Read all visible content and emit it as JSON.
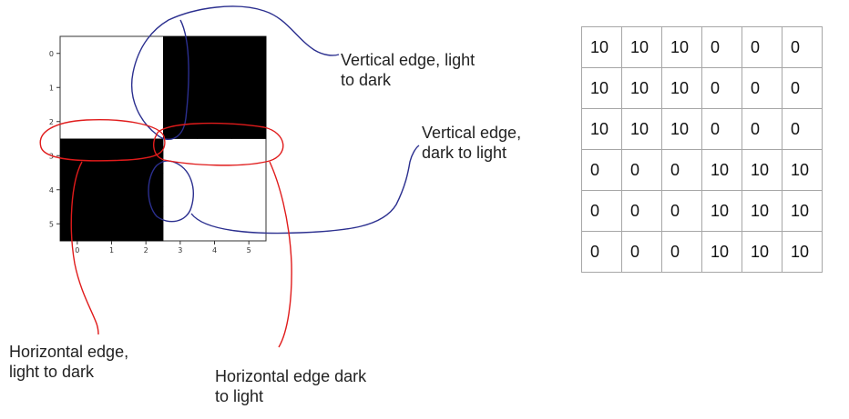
{
  "plot": {
    "image": [
      [
        0,
        0,
        0,
        1,
        1,
        1
      ],
      [
        0,
        0,
        0,
        1,
        1,
        1
      ],
      [
        0,
        0,
        0,
        1,
        1,
        1
      ],
      [
        1,
        1,
        1,
        0,
        0,
        0
      ],
      [
        1,
        1,
        1,
        0,
        0,
        0
      ],
      [
        1,
        1,
        1,
        0,
        0,
        0
      ]
    ],
    "x_ticks": [
      "0",
      "1",
      "2",
      "3",
      "4",
      "5"
    ],
    "y_ticks": [
      "0",
      "1",
      "2",
      "3",
      "4",
      "5"
    ],
    "colors": {
      "dark": "#000000",
      "light": "#ffffff",
      "frame": "#333333"
    }
  },
  "annotations": {
    "vertical_light_to_dark": {
      "lines": [
        "Vertical edge, light",
        "to dark"
      ],
      "color": "#2b2f8f"
    },
    "vertical_dark_to_light": {
      "lines": [
        "Vertical edge,",
        "dark to light"
      ],
      "color": "#2b2f8f"
    },
    "horizontal_light_to_dark": {
      "lines": [
        "Horizontal edge,",
        "light to dark"
      ],
      "color": "#e01b1b"
    },
    "horizontal_dark_to_light": {
      "lines": [
        "Horizontal edge dark",
        "to light"
      ],
      "color": "#e01b1b"
    }
  },
  "matrix": {
    "rows": [
      [
        "10",
        "10",
        "10",
        "0",
        "0",
        "0"
      ],
      [
        "10",
        "10",
        "10",
        "0",
        "0",
        "0"
      ],
      [
        "10",
        "10",
        "10",
        "0",
        "0",
        "0"
      ],
      [
        "0",
        "0",
        "0",
        "10",
        "10",
        "10"
      ],
      [
        "0",
        "0",
        "0",
        "10",
        "10",
        "10"
      ],
      [
        "0",
        "0",
        "0",
        "10",
        "10",
        "10"
      ]
    ]
  }
}
